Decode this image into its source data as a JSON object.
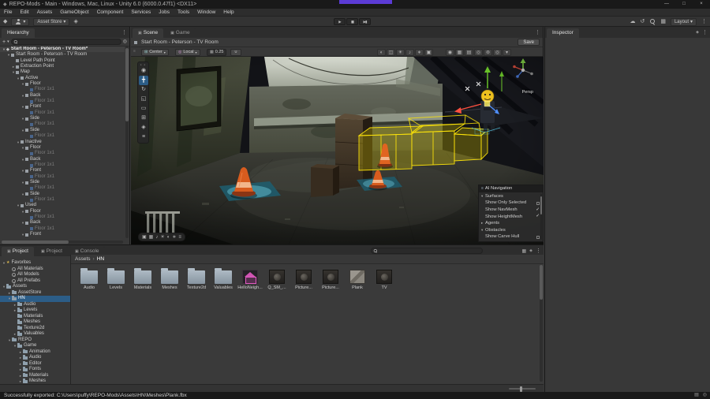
{
  "title_bar": {
    "title": "REPO-Mods - Main - Windows, Mac, Linux - Unity 6.0 (6000.0.47f1) <DX11>"
  },
  "menu_bar": {
    "items": [
      "File",
      "Edit",
      "Assets",
      "GameObject",
      "Component",
      "Services",
      "Jobs",
      "Tools",
      "Window",
      "Help"
    ]
  },
  "toolbar": {
    "asset_store_label": "Asset Store",
    "layout_label": "Layout",
    "play_controls": [
      "play",
      "pause",
      "step"
    ]
  },
  "hierarchy": {
    "tab": "Hierarchy",
    "rows": [
      {
        "label": "Start Room - Peterson - TV Room*",
        "indent": 0,
        "arrow": "down",
        "kind": "scene"
      },
      {
        "label": "Start Room - Peterson - TV Room",
        "indent": 1,
        "arrow": "down",
        "kind": "go"
      },
      {
        "label": "Level Path Point",
        "indent": 2,
        "arrow": "none",
        "kind": "go"
      },
      {
        "label": "Extraction Point",
        "indent": 2,
        "arrow": "right",
        "kind": "go"
      },
      {
        "label": "Map",
        "indent": 2,
        "arrow": "down",
        "kind": "go"
      },
      {
        "label": "Active",
        "indent": 3,
        "arrow": "down",
        "kind": "go"
      },
      {
        "label": "Floor",
        "indent": 4,
        "arrow": "down",
        "kind": "go"
      },
      {
        "label": "Floor 1x1",
        "indent": 5,
        "arrow": "none",
        "kind": "dim"
      },
      {
        "label": "Back",
        "indent": 4,
        "arrow": "down",
        "kind": "go"
      },
      {
        "label": "Floor 1x1",
        "indent": 5,
        "arrow": "none",
        "kind": "dim"
      },
      {
        "label": "Front",
        "indent": 4,
        "arrow": "down",
        "kind": "go"
      },
      {
        "label": "Floor 1x1",
        "indent": 5,
        "arrow": "none",
        "kind": "dim"
      },
      {
        "label": "Side",
        "indent": 4,
        "arrow": "down",
        "kind": "go"
      },
      {
        "label": "Floor 1x1",
        "indent": 5,
        "arrow": "none",
        "kind": "dim"
      },
      {
        "label": "Side",
        "indent": 4,
        "arrow": "down",
        "kind": "go"
      },
      {
        "label": "Floor 1x1",
        "indent": 5,
        "arrow": "none",
        "kind": "dim"
      },
      {
        "label": "Inactive",
        "indent": 3,
        "arrow": "down",
        "kind": "go"
      },
      {
        "label": "Floor",
        "indent": 4,
        "arrow": "down",
        "kind": "go"
      },
      {
        "label": "Floor 1x1",
        "indent": 5,
        "arrow": "none",
        "kind": "dim"
      },
      {
        "label": "Back",
        "indent": 4,
        "arrow": "down",
        "kind": "go"
      },
      {
        "label": "Floor 1x1",
        "indent": 5,
        "arrow": "none",
        "kind": "dim"
      },
      {
        "label": "Front",
        "indent": 4,
        "arrow": "down",
        "kind": "go"
      },
      {
        "label": "Floor 1x1",
        "indent": 5,
        "arrow": "none",
        "kind": "dim"
      },
      {
        "label": "Side",
        "indent": 4,
        "arrow": "down",
        "kind": "go"
      },
      {
        "label": "Floor 1x1",
        "indent": 5,
        "arrow": "none",
        "kind": "dim"
      },
      {
        "label": "Side",
        "indent": 4,
        "arrow": "down",
        "kind": "go"
      },
      {
        "label": "Floor 1x1",
        "indent": 5,
        "arrow": "none",
        "kind": "dim"
      },
      {
        "label": "Used",
        "indent": 3,
        "arrow": "down",
        "kind": "go"
      },
      {
        "label": "Floor",
        "indent": 4,
        "arrow": "down",
        "kind": "go"
      },
      {
        "label": "Floor 1x1",
        "indent": 5,
        "arrow": "none",
        "kind": "dim"
      },
      {
        "label": "Back",
        "indent": 4,
        "arrow": "down",
        "kind": "go"
      },
      {
        "label": "Floor 1x1",
        "indent": 5,
        "arrow": "none",
        "kind": "dim"
      },
      {
        "label": "Front",
        "indent": 4,
        "arrow": "down",
        "kind": "go"
      }
    ]
  },
  "scene_view": {
    "tabs": [
      {
        "label": "Scene",
        "active": true
      },
      {
        "label": "Game",
        "active": false
      }
    ],
    "scene_name": "Start Room - Peterson - TV Room",
    "save_label": "Save",
    "pivot": "Center",
    "space": "Local",
    "snap_value": "0.25",
    "persp_label": "Persp",
    "tools": [
      "view",
      "move",
      "rotate",
      "scale",
      "rect",
      "transform",
      "custom",
      "more"
    ],
    "active_tool_index": 1,
    "mid_icons": [
      "shading",
      "wireframe",
      "lighting",
      "audio",
      "effects",
      "camera"
    ],
    "right_icons": [
      "vis",
      "grid",
      "layers",
      "eye",
      "settings",
      "gizmo",
      "caret"
    ],
    "bottom_icons": [
      "camera",
      "grid",
      "audio",
      "lighting",
      "shading",
      "effects",
      "more"
    ]
  },
  "nav_overlay": {
    "title": "AI Navigation",
    "rows": [
      {
        "label": "Surfaces",
        "fold": "open"
      },
      {
        "label": "Show Only Selected",
        "check": "unchecked"
      },
      {
        "label": "Show NavMesh",
        "check": "checked"
      },
      {
        "label": "Show HeightMesh",
        "check": "checked"
      },
      {
        "label": "Agents",
        "fold": "closed"
      },
      {
        "label": "Obstacles",
        "fold": "open"
      },
      {
        "label": "Show Carve Hull",
        "check": "unchecked"
      }
    ]
  },
  "inspector": {
    "tab": "Inspector"
  },
  "project": {
    "tabs": [
      {
        "label": "Project",
        "active": true
      },
      {
        "label": "Project",
        "active": false
      },
      {
        "label": "Console",
        "active": false
      }
    ],
    "tree": [
      {
        "label": "Favorites",
        "indent": 0,
        "arrow": "down",
        "icon": "star"
      },
      {
        "label": "All Materials",
        "indent": 1,
        "arrow": "none",
        "icon": "lens"
      },
      {
        "label": "All Models",
        "indent": 1,
        "arrow": "none",
        "icon": "lens"
      },
      {
        "label": "All Prefabs",
        "indent": 1,
        "arrow": "none",
        "icon": "lens"
      },
      {
        "label": "Assets",
        "indent": 0,
        "arrow": "down",
        "icon": "folder"
      },
      {
        "label": "AssetStore",
        "indent": 1,
        "arrow": "right",
        "icon": "folder"
      },
      {
        "label": "HN",
        "indent": 1,
        "arrow": "down",
        "icon": "folder",
        "selected": true
      },
      {
        "label": "Audio",
        "indent": 2,
        "arrow": "right",
        "icon": "folder"
      },
      {
        "label": "Levels",
        "indent": 2,
        "arrow": "right",
        "icon": "folder"
      },
      {
        "label": "Materials",
        "indent": 2,
        "arrow": "none",
        "icon": "folder"
      },
      {
        "label": "Meshes",
        "indent": 2,
        "arrow": "none",
        "icon": "folder"
      },
      {
        "label": "Texture2d",
        "indent": 2,
        "arrow": "none",
        "icon": "folder"
      },
      {
        "label": "Valuables",
        "indent": 2,
        "arrow": "right",
        "icon": "folder"
      },
      {
        "label": "REPO",
        "indent": 1,
        "arrow": "down",
        "icon": "folder"
      },
      {
        "label": "Game",
        "indent": 2,
        "arrow": "down",
        "icon": "folder"
      },
      {
        "label": "Animation",
        "indent": 3,
        "arrow": "right",
        "icon": "folder"
      },
      {
        "label": "Audio",
        "indent": 3,
        "arrow": "right",
        "icon": "folder"
      },
      {
        "label": "Editor",
        "indent": 3,
        "arrow": "right",
        "icon": "folder"
      },
      {
        "label": "Fonts",
        "indent": 3,
        "arrow": "right",
        "icon": "folder"
      },
      {
        "label": "Materials",
        "indent": 3,
        "arrow": "right",
        "icon": "folder"
      },
      {
        "label": "Meshes",
        "indent": 3,
        "arrow": "right",
        "icon": "folder"
      }
    ],
    "breadcrumb": {
      "root": "Assets",
      "separator": "›",
      "current": "HN"
    },
    "items": [
      {
        "name": "Audio",
        "kind": "folder"
      },
      {
        "name": "Levels",
        "kind": "folder"
      },
      {
        "name": "Materials",
        "kind": "folder"
      },
      {
        "name": "Meshes",
        "kind": "folder"
      },
      {
        "name": "Texture2d",
        "kind": "folder"
      },
      {
        "name": "Valuables",
        "kind": "folder"
      },
      {
        "name": "HelloNeigh...",
        "kind": "prefab-pink"
      },
      {
        "name": "Q_SM_...",
        "kind": "asset-dark"
      },
      {
        "name": "Picture...",
        "kind": "asset-dark"
      },
      {
        "name": "Picture...",
        "kind": "asset-dark"
      },
      {
        "name": "Plank",
        "kind": "asset-gray"
      },
      {
        "name": "TV",
        "kind": "asset-dark"
      }
    ]
  },
  "status_bar": {
    "message": "Successfully exported: C:\\Users\\puffy\\REPO-Mods\\Assets\\HN\\Meshes\\Plank.fbx"
  }
}
